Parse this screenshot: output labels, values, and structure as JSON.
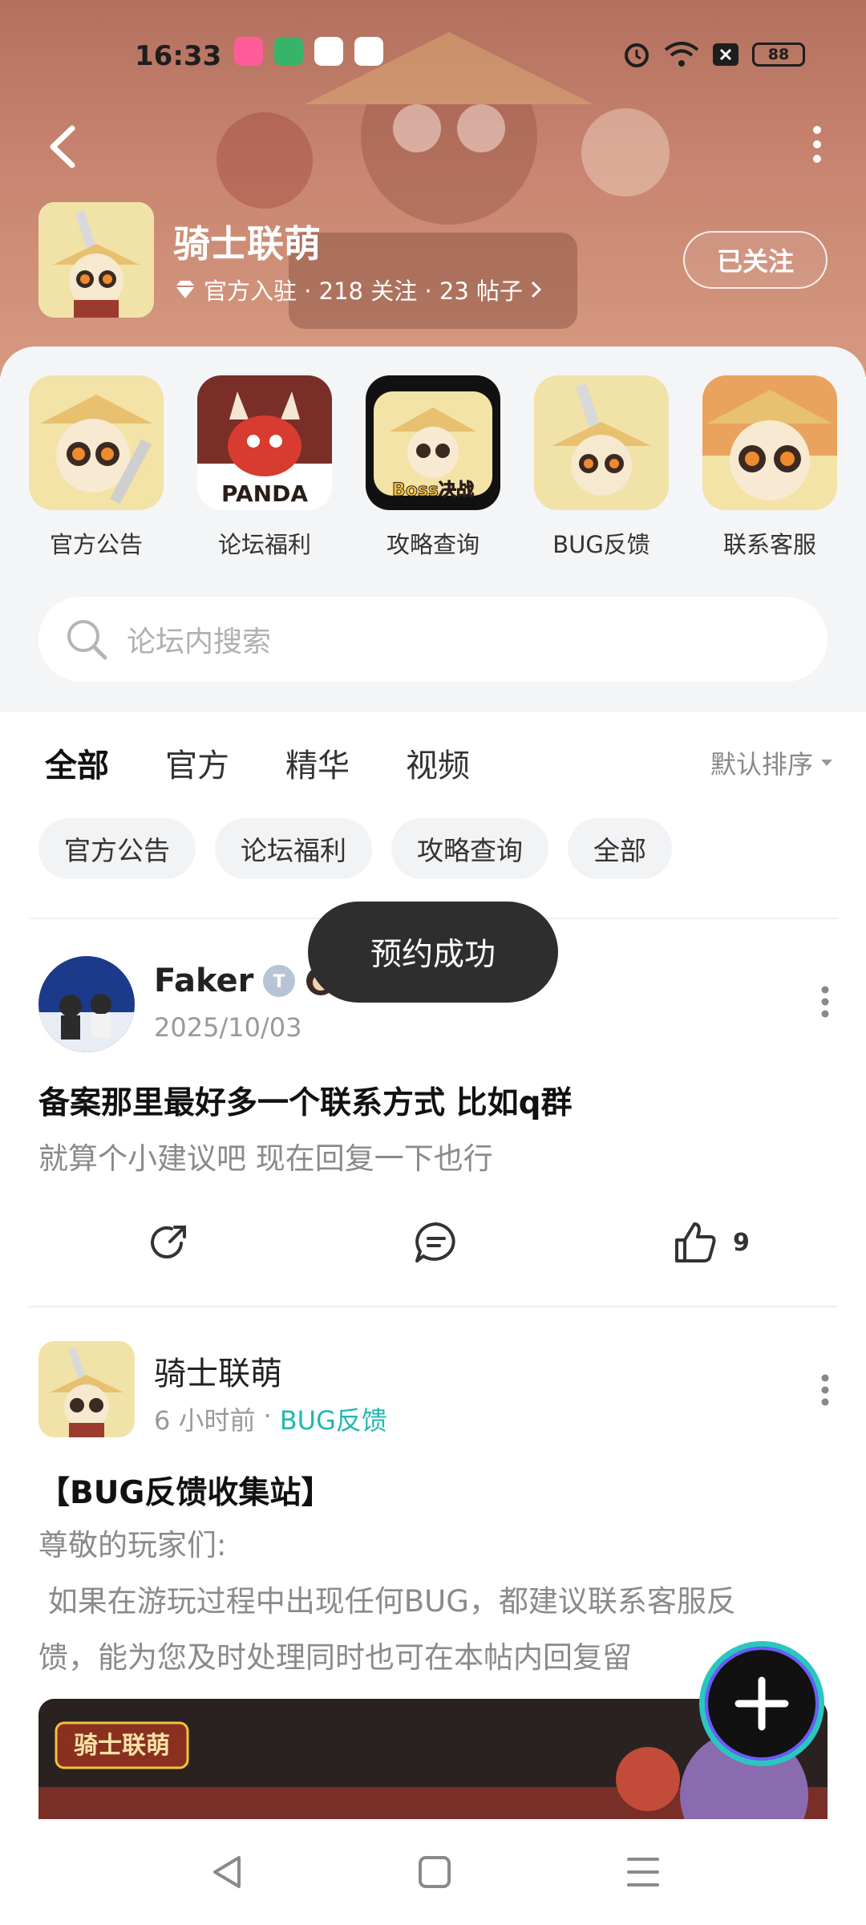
{
  "status_bar": {
    "time": "16:33",
    "battery": "88"
  },
  "forum": {
    "name": "骑士联萌",
    "stats": "官方入驻 · 218 关注 · 23 帖子",
    "follow_label": "已关注"
  },
  "shortcuts": [
    {
      "label": "官方公告",
      "icon": "panda-knight-icon"
    },
    {
      "label": "论坛福利",
      "icon": "red-dragon-panda-icon",
      "icon_text": "PANDA"
    },
    {
      "label": "攻略查询",
      "icon": "boss-guide-icon",
      "icon_text": "Boss决战"
    },
    {
      "label": "BUG反馈",
      "icon": "panda-knight-icon"
    },
    {
      "label": "联系客服",
      "icon": "panda-face-icon"
    }
  ],
  "search": {
    "placeholder": "论坛内搜索"
  },
  "tabs": [
    "全部",
    "官方",
    "精华",
    "视频"
  ],
  "sort_label": "默认排序",
  "filters": [
    "官方公告",
    "论坛福利",
    "攻略查询",
    "全部"
  ],
  "toast": "预约成功",
  "posts": [
    {
      "author": "Faker",
      "date": "2025/10/03",
      "title": "备案那里最好多一个联系方式 比如q群",
      "body": "就算个小建议吧 现在回复一下也行",
      "likes": "9"
    },
    {
      "author": "骑士联萌",
      "time_ago": "6 小时前",
      "tag": "BUG反馈",
      "title": "【BUG反馈收集站】",
      "body_line1": "尊敬的玩家们:",
      "body_line2": " 如果在游玩过程中出现任何BUG，都建议联系客服反",
      "body_line3": "馈，能为您及时处理同时也可在本帖内回复留"
    }
  ],
  "image_logo": "骑士联萌",
  "colors": {
    "accent": "#2cc6c0",
    "banner": "#c88571",
    "tag": "#22b8b0"
  }
}
